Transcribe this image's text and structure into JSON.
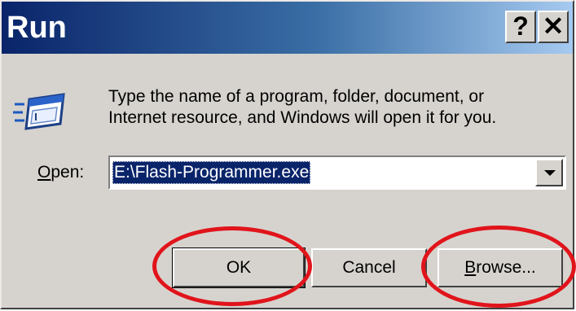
{
  "window": {
    "title": "Run",
    "help_button": "?",
    "close_button": "✕"
  },
  "description": {
    "line1": "Type the name of a program, folder, document, or",
    "line2": "Internet resource, and Windows will open it for you."
  },
  "open_field": {
    "label_prefix": "O",
    "label_rest": "pen:",
    "value": "E:\\Flash-Programmer.exe"
  },
  "buttons": {
    "ok": "OK",
    "cancel": "Cancel",
    "browse_prefix": "B",
    "browse_rest": "rowse..."
  },
  "colors": {
    "title_bar": "#0a246a",
    "dialog_face": "#d6d3ce",
    "annotation": "#e1141b"
  },
  "icons": {
    "run": "run-program-icon",
    "dropdown": "chevron-down-icon"
  }
}
